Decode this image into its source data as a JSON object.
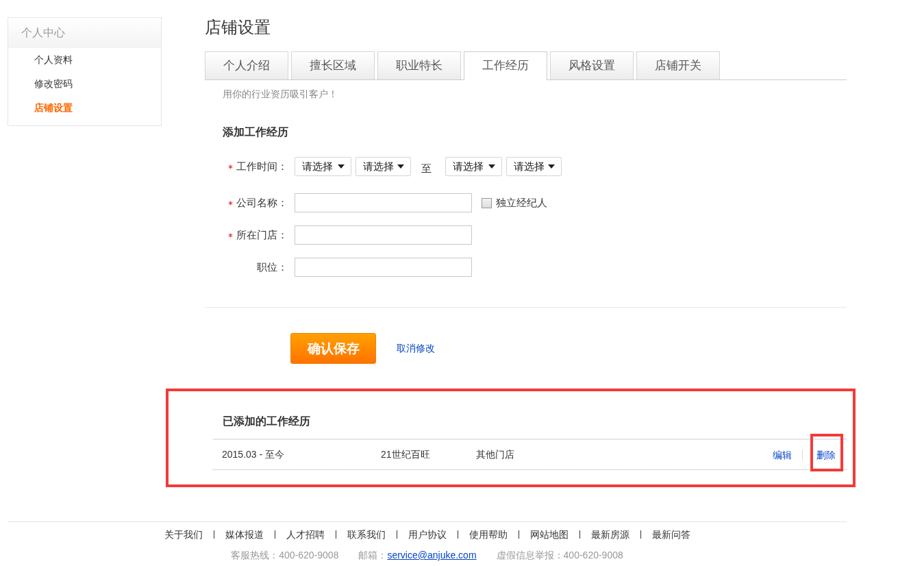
{
  "sidebar": {
    "title": "个人中心",
    "items": [
      {
        "label": "个人资料",
        "selected": false
      },
      {
        "label": "修改密码",
        "selected": false
      },
      {
        "label": "店铺设置",
        "selected": true
      }
    ]
  },
  "page_title": "店铺设置",
  "tabs": [
    {
      "label": "个人介绍",
      "selected": false
    },
    {
      "label": "擅长区域",
      "selected": false
    },
    {
      "label": "职业特长",
      "selected": false
    },
    {
      "label": "工作经历",
      "selected": true
    },
    {
      "label": "风格设置",
      "selected": false
    },
    {
      "label": "店铺开关",
      "selected": false
    }
  ],
  "tab_hint": "用你的行业资历吸引客户！",
  "form": {
    "title": "添加工作经历",
    "fields": [
      {
        "kind": "period",
        "label": "工作时间：",
        "required": true,
        "start": [
          "请选择",
          "请选择"
        ],
        "separator": "至",
        "end": [
          "请选择",
          "请选择"
        ]
      },
      {
        "kind": "text",
        "label": "公司名称：",
        "required": true,
        "checkbox": {
          "label": "独立经纪人",
          "checked": false
        }
      },
      {
        "kind": "text",
        "label": "所在门店：",
        "required": true
      },
      {
        "kind": "text",
        "label": "职位：",
        "required": false
      }
    ]
  },
  "actions": {
    "save": "确认保存",
    "cancel": "取消修改"
  },
  "added": {
    "title": "已添加的工作经历",
    "highlighted": true,
    "rows": [
      {
        "period": "2015.03 - 至今",
        "company": "21世纪百旺",
        "store": "其他门店",
        "edit": "编辑",
        "delete": "删除",
        "delete_highlighted": true
      }
    ]
  },
  "footer": {
    "links": [
      "关于我们",
      "媒体报道",
      "人才招聘",
      "联系我们",
      "用户协议",
      "使用帮助",
      "网站地图",
      "最新房源",
      "最新问答"
    ],
    "contacts": [
      {
        "kind": "text",
        "text": "客服热线：400-620-9008"
      },
      {
        "kind": "email",
        "label": "邮箱：",
        "link": "service@anjuke.com"
      },
      {
        "kind": "text",
        "text": "虚假信息举报：400-620-9008"
      }
    ]
  }
}
